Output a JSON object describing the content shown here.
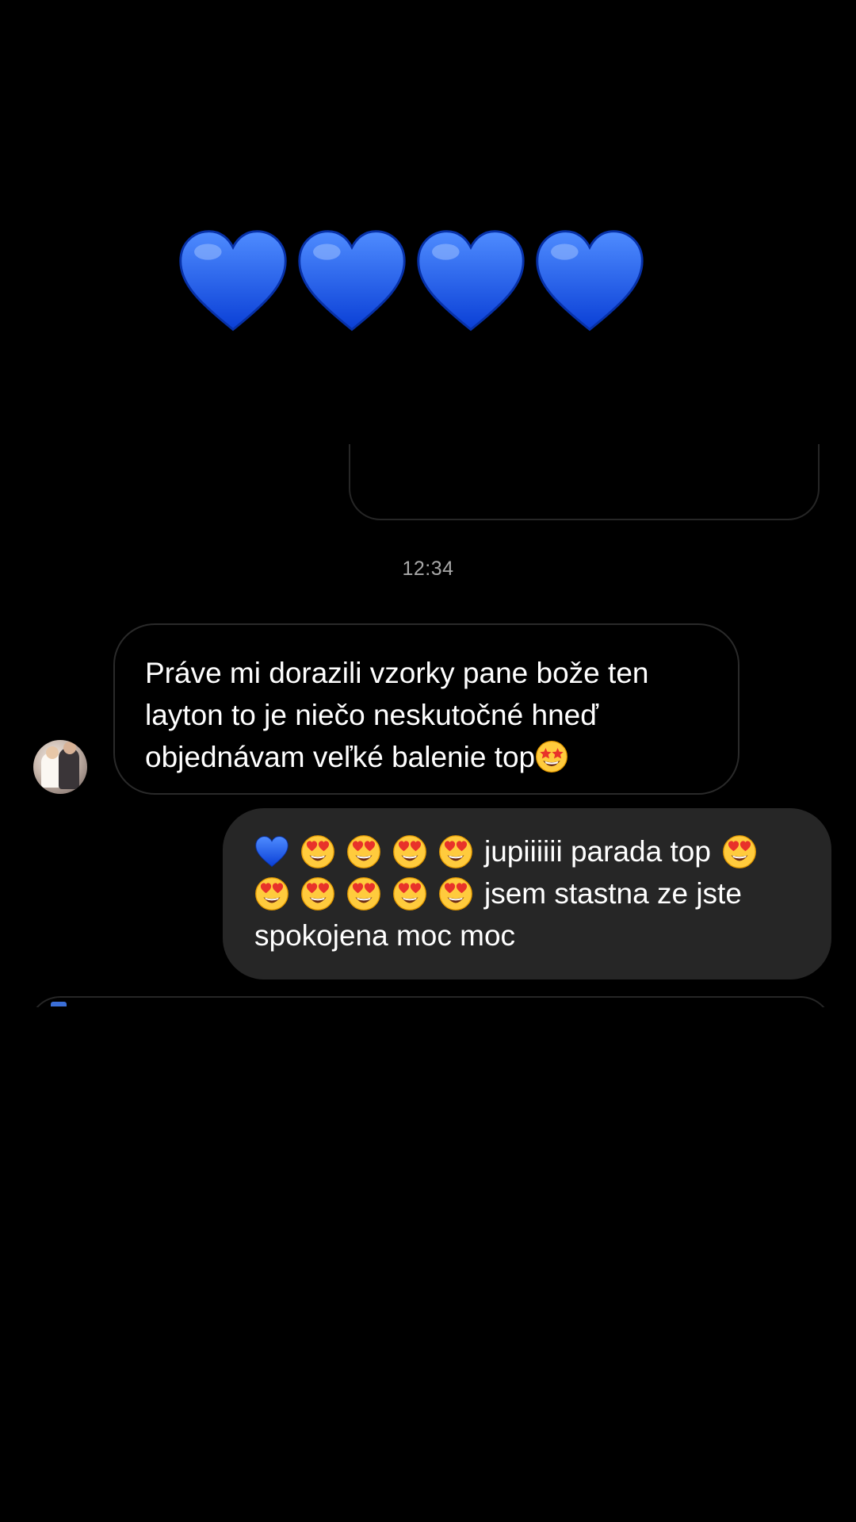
{
  "conversation": {
    "hearts_message": {
      "emoji": [
        "blue-heart",
        "blue-heart",
        "blue-heart",
        "blue-heart"
      ],
      "color": "#1f6cff"
    },
    "timestamp": "12:34",
    "incoming": {
      "text": "Práve mi dorazili vzorky pane bože ten\nlayton to je niečo neskutočné hneď\nobjednávam veľké balenie top",
      "trailing_emoji": "star-struck"
    },
    "outgoing": {
      "line1_text": "jupiiiiii parada top",
      "line2_text": "jsem stastna ze jste",
      "line3_text": "spokojena moc moc",
      "emoji": [
        "blue-heart",
        "heart-eyes"
      ]
    }
  }
}
